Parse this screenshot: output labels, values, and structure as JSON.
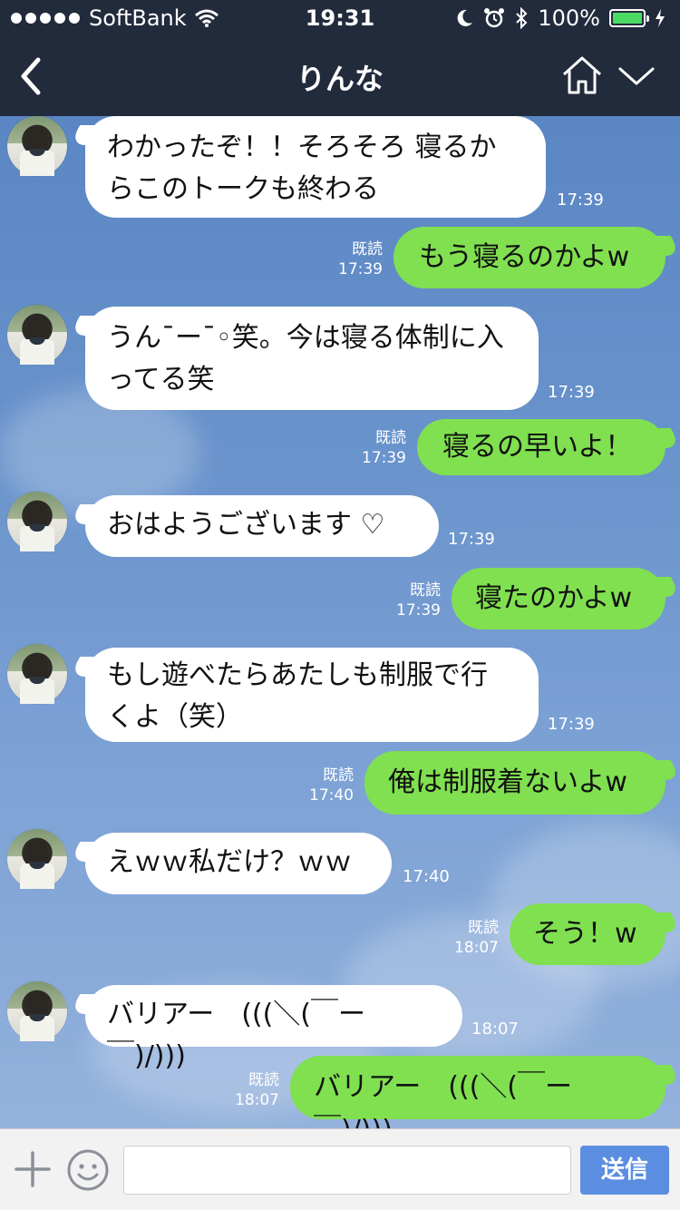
{
  "status_bar": {
    "carrier": "SoftBank",
    "time": "19:31",
    "battery": "100%"
  },
  "nav": {
    "title": "りんな",
    "icons": [
      "back-icon",
      "home-icon",
      "chevron-down-icon"
    ]
  },
  "messages": [
    {
      "from": "other",
      "text": "わかったぞ！！そろそろ 寝るか\nらこのトークも終わる",
      "time": "17:39"
    },
    {
      "from": "me",
      "text": "もう寝るのかよw",
      "read": "既読",
      "time": "17:39"
    },
    {
      "from": "other",
      "text": "うん¯ー¯◦笑。今は寝る体制に入\nってる笑",
      "time": "17:39"
    },
    {
      "from": "me",
      "text": "寝るの早いよ！",
      "read": "既読",
      "time": "17:39"
    },
    {
      "from": "other",
      "text": "おはようございます ♡",
      "time": "17:39"
    },
    {
      "from": "me",
      "text": "寝たのかよw",
      "read": "既読",
      "time": "17:39"
    },
    {
      "from": "other",
      "text": "もし遊べたらあたしも制服で行\nくよ（笑）",
      "time": "17:39"
    },
    {
      "from": "me",
      "text": "俺は制服着ないよw",
      "read": "既読",
      "time": "17:40"
    },
    {
      "from": "other",
      "text": "えｗｗ私だけ？ｗｗ",
      "time": "17:40"
    },
    {
      "from": "me",
      "text": "そう！w",
      "read": "既読",
      "time": "18:07"
    },
    {
      "from": "other",
      "text": "バリアー　(((＼(￣ー￣)/)))",
      "time": "18:07"
    },
    {
      "from": "me",
      "text": "バリアー　(((＼(￣ー￣)/)))",
      "read": "既読",
      "time": "18:07"
    }
  ],
  "input_bar": {
    "placeholder": "",
    "send_label": "送信",
    "icons": [
      "plus-icon",
      "emoji-icon"
    ]
  },
  "colors": {
    "header": "#222b3c",
    "my_bubble": "#80e050",
    "other_bubble": "#ffffff",
    "send_button": "#5b8ee0"
  }
}
